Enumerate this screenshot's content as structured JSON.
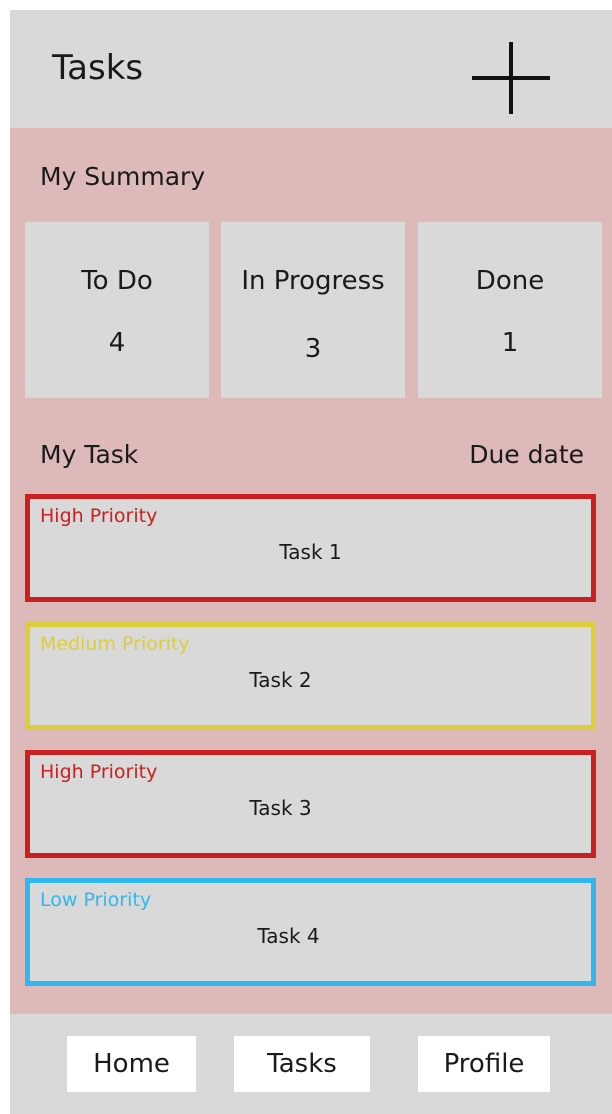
{
  "header": {
    "title": "Tasks",
    "add_icon": "plus-icon"
  },
  "summary": {
    "title": "My Summary",
    "cards": [
      {
        "label": "To Do",
        "count": "4"
      },
      {
        "label": "In Progress",
        "count": "3"
      },
      {
        "label": "Done",
        "count": "1"
      }
    ]
  },
  "task_list": {
    "title": "My Task",
    "due_label": "Due date",
    "items": [
      {
        "priority": "High Priority",
        "name": "Task 1",
        "color": "#cc1f1f"
      },
      {
        "priority": "Medium Priority",
        "name": "Task 2",
        "color": "#dccd3a"
      },
      {
        "priority": "High Priority",
        "name": "Task 3",
        "color": "#cc1f1f"
      },
      {
        "priority": "Low Priority",
        "name": "Task 4",
        "color": "#2eb7f0"
      }
    ]
  },
  "nav": {
    "items": [
      {
        "label": "Home"
      },
      {
        "label": "Tasks"
      },
      {
        "label": "Profile"
      }
    ]
  },
  "colors": {
    "header_bg": "#d9d9d9",
    "content_bg": "#deb9b9",
    "card_bg": "#d9d9d9"
  }
}
